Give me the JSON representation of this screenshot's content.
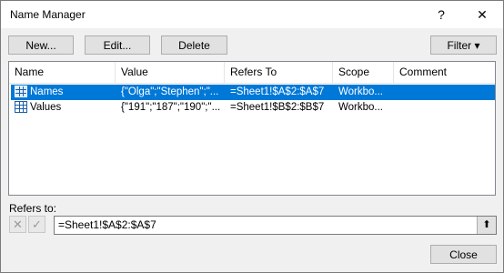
{
  "window": {
    "title": "Name Manager",
    "help_glyph": "?",
    "close_glyph": "✕"
  },
  "toolbar": {
    "new_label": "New...",
    "edit_label": "Edit...",
    "delete_label": "Delete",
    "filter_label": "Filter",
    "filter_arrow": "▾"
  },
  "table": {
    "columns": [
      "Name",
      "Value",
      "Refers To",
      "Scope",
      "Comment"
    ],
    "rows": [
      {
        "name": "Names",
        "value": "{\"Olga\";\"Stephen\";\"...",
        "refers_to": "=Sheet1!$A$2:$A$7",
        "scope": "Workbo...",
        "comment": "",
        "selected": true
      },
      {
        "name": "Values",
        "value": "{\"191\";\"187\";\"190\";\"...",
        "refers_to": "=Sheet1!$B$2:$B$7",
        "scope": "Workbo...",
        "comment": "",
        "selected": false
      }
    ]
  },
  "refers_to": {
    "label": "Refers to:",
    "value": "=Sheet1!$A$2:$A$7",
    "cancel_glyph": "✕",
    "confirm_glyph": "✓",
    "collapse_glyph": "⬆"
  },
  "footer": {
    "close_label": "Close"
  },
  "colors": {
    "selection": "#0078d7",
    "grid_icon": "#1f5fa8"
  }
}
